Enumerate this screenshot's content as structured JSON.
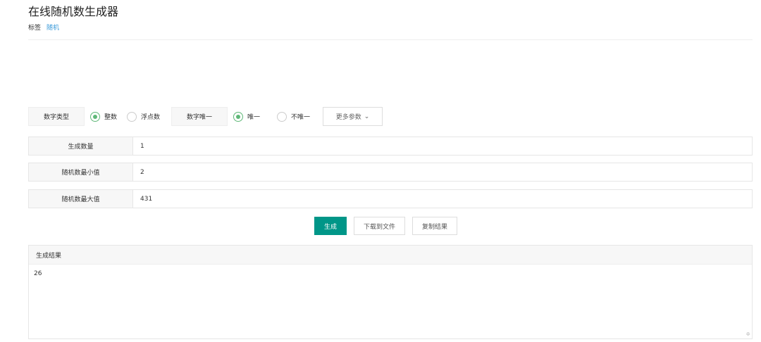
{
  "header": {
    "title": "在线随机数生成器",
    "tags_label": "标签",
    "tag": "随机"
  },
  "options": {
    "type_label": "数字类型",
    "type_options": [
      "整数",
      "浮点数"
    ],
    "type_selected": 0,
    "unique_label": "数字唯一",
    "unique_options": [
      "唯一",
      "不唯一"
    ],
    "unique_selected": 0,
    "more_label": "更多参数"
  },
  "fields": [
    {
      "label": "生成数量",
      "value": "1"
    },
    {
      "label": "随机数最小值",
      "value": "2"
    },
    {
      "label": "随机数最大值",
      "value": "431"
    }
  ],
  "buttons": {
    "generate": "生成",
    "download": "下载到文件",
    "copy": "复制结果"
  },
  "result": {
    "label": "生成结果",
    "value": "26"
  }
}
